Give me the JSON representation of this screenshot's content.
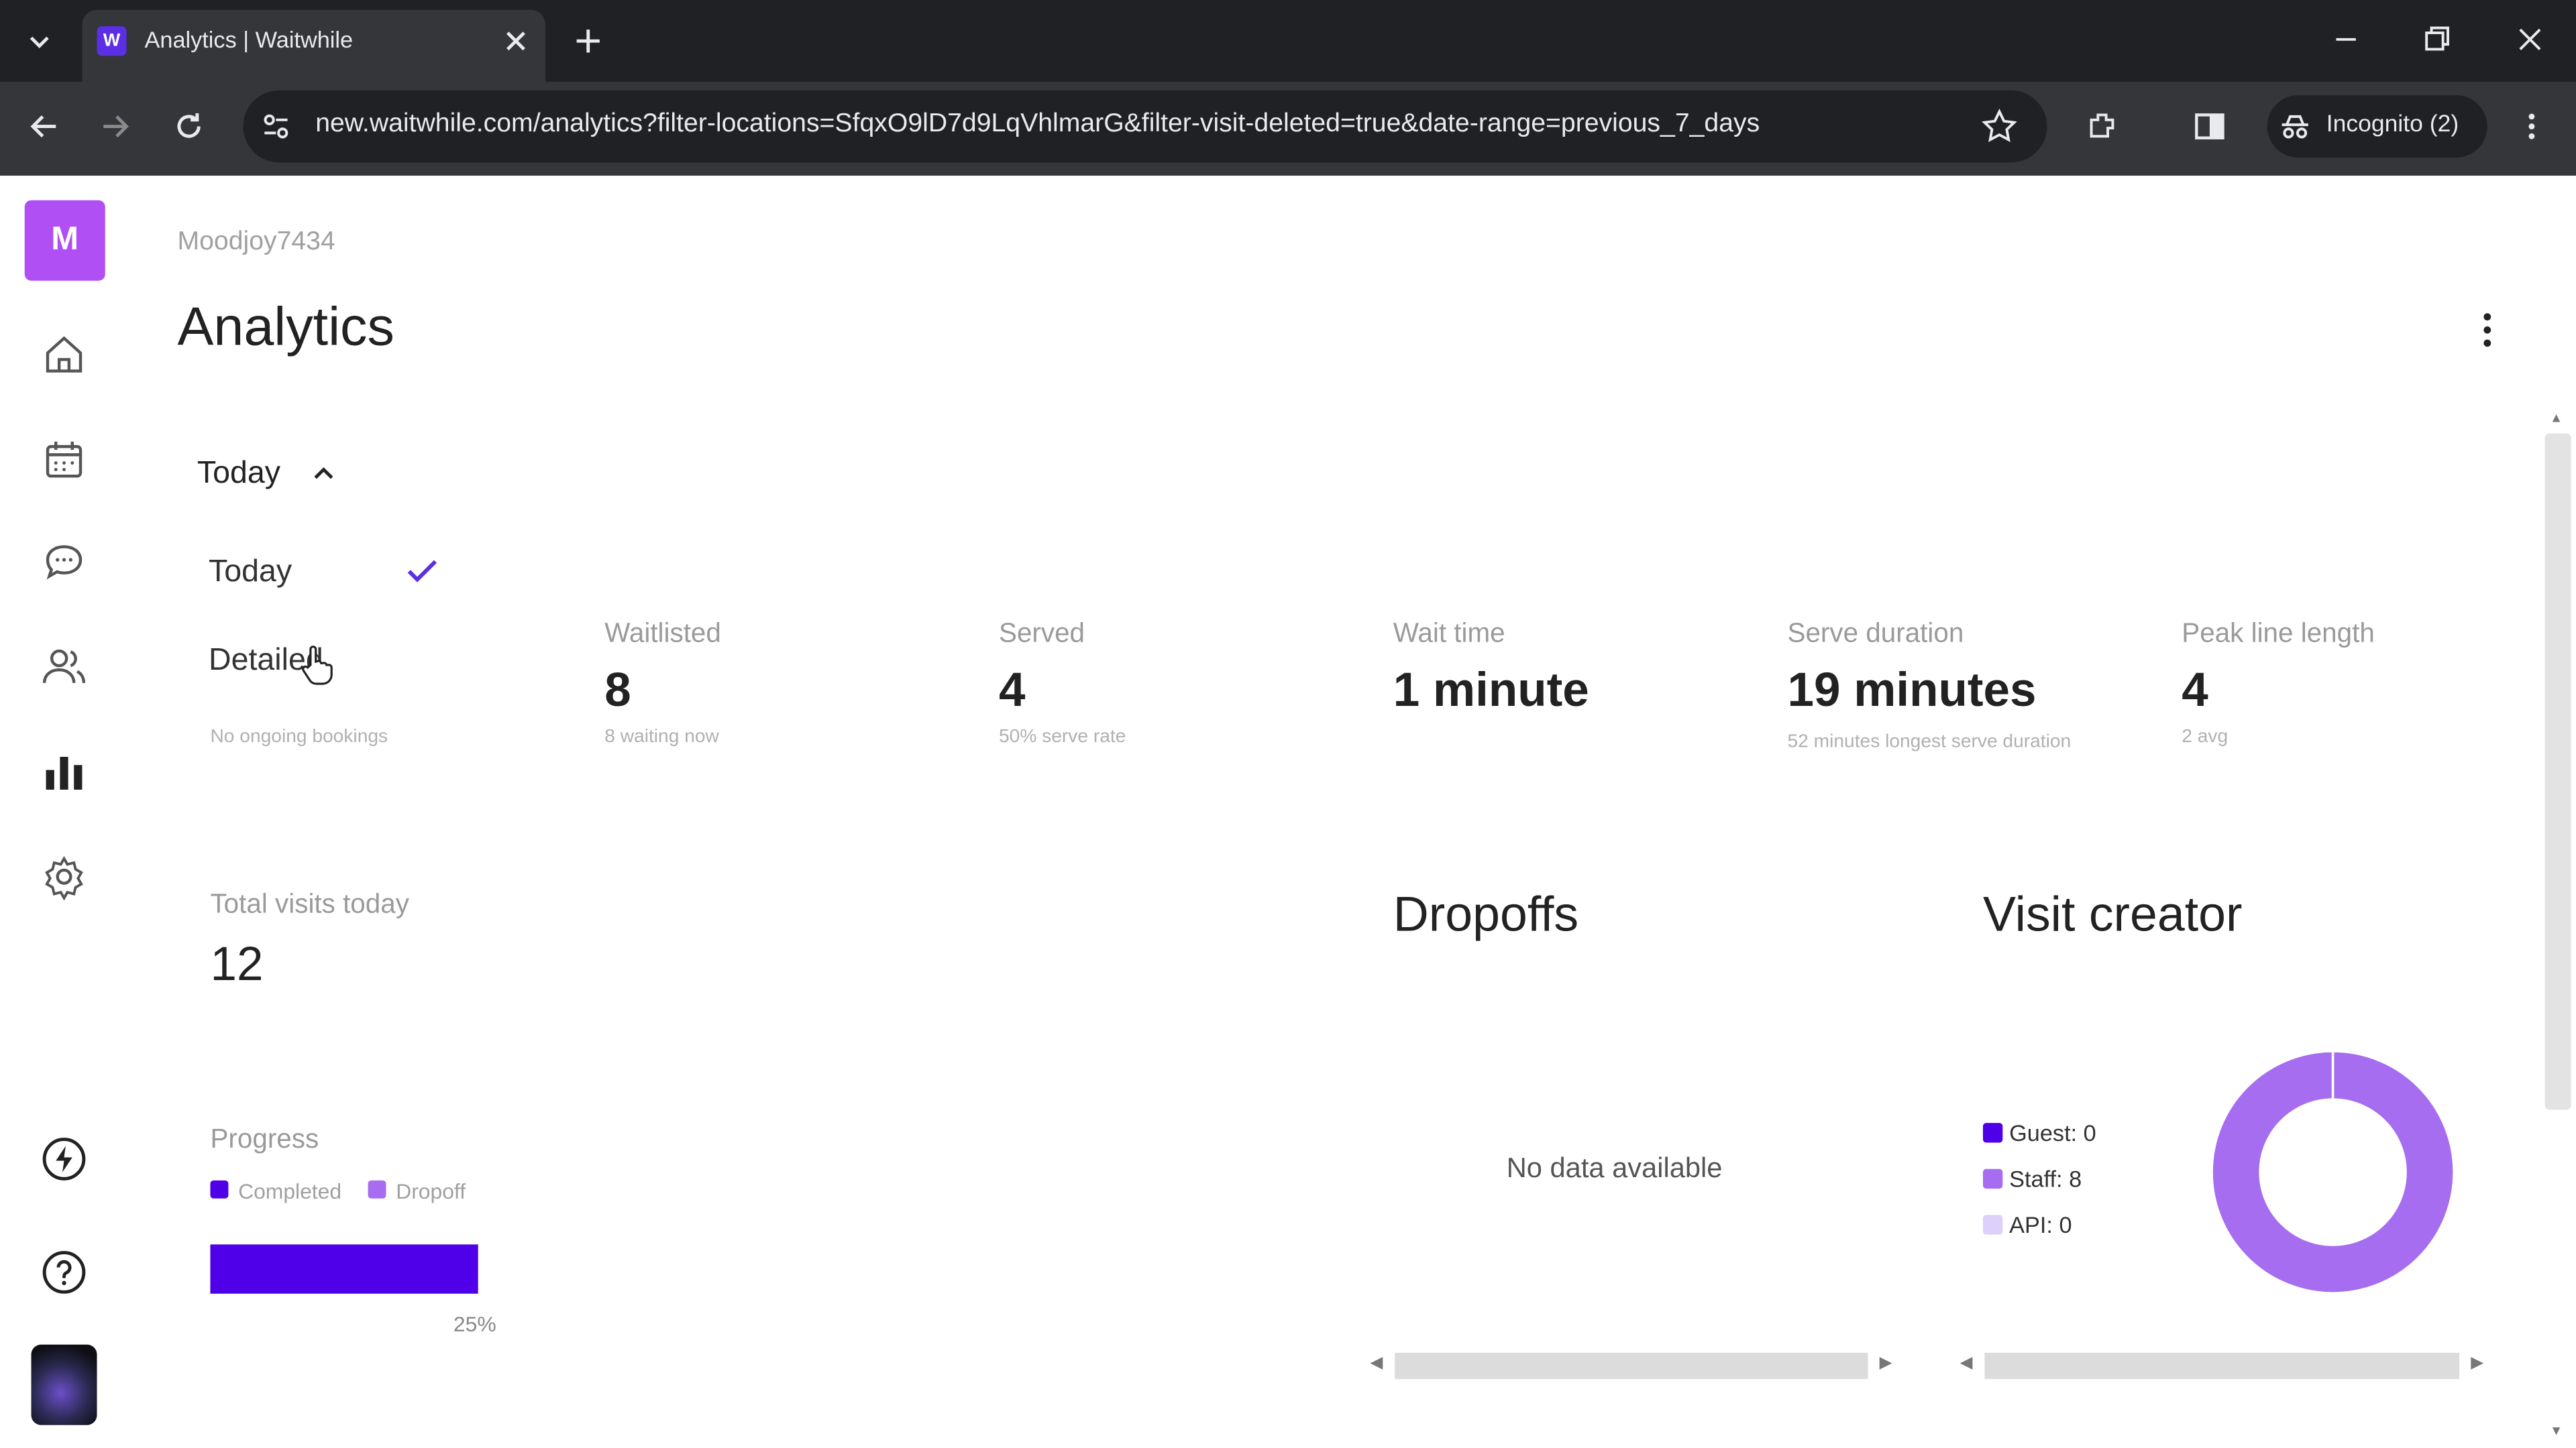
{
  "browser": {
    "tab_title": "Analytics | Waitwhile",
    "favicon_letter": "W",
    "url": "new.waitwhile.com/analytics?filter-locations=SfqxO9lD7d9LqVhlmarG&filter-visit-deleted=true&date-range=previous_7_days",
    "incognito_label": "Incognito (2)"
  },
  "rail": {
    "workspace_initial": "M",
    "icons": [
      "home-icon",
      "calendar-icon",
      "chat-icon",
      "users-icon",
      "analytics-icon",
      "settings-icon",
      "bolt-icon",
      "help-icon"
    ]
  },
  "header": {
    "workspace_name": "Moodjoy7434",
    "title": "Analytics"
  },
  "date_filter": {
    "selected": "Today",
    "options": [
      {
        "label": "Today",
        "checked": true
      },
      {
        "label": "Detailed",
        "checked": false
      }
    ],
    "note": "No ongoing bookings"
  },
  "stats": [
    {
      "label": "Waitlisted",
      "value": "8",
      "sub": "8 waiting now"
    },
    {
      "label": "Served",
      "value": "4",
      "sub": "50% serve rate"
    },
    {
      "label": "Wait time",
      "value": "1 minute",
      "sub": ""
    },
    {
      "label": "Serve duration",
      "value": "19 minutes",
      "sub": "52 minutes longest serve duration"
    },
    {
      "label": "Peak line length",
      "value": "4",
      "sub": "2 avg"
    }
  ],
  "total_visits": {
    "label": "Total visits today",
    "value": "12"
  },
  "progress": {
    "label": "Progress",
    "legend": [
      {
        "name": "Completed",
        "color": "#4f00e8"
      },
      {
        "name": "Dropoff",
        "color": "#a66df0"
      }
    ],
    "percent_label": "25%",
    "completed_fraction": 1.0
  },
  "dropoffs": {
    "title": "Dropoffs",
    "empty_text": "No data available"
  },
  "visit_creator": {
    "title": "Visit creator",
    "legend": [
      {
        "label": "Guest: 0",
        "color": "#4f00e8"
      },
      {
        "label": "Staff: 8",
        "color": "#a66df0"
      },
      {
        "label": "API: 0",
        "color": "#ddd0fa"
      }
    ]
  },
  "chart_data": {
    "type": "pie",
    "title": "Visit creator",
    "categories": [
      "Guest",
      "Staff",
      "API"
    ],
    "values": [
      0,
      8,
      0
    ],
    "colors": [
      "#4f00e8",
      "#a66df0",
      "#ddd0fa"
    ],
    "donut": true
  }
}
